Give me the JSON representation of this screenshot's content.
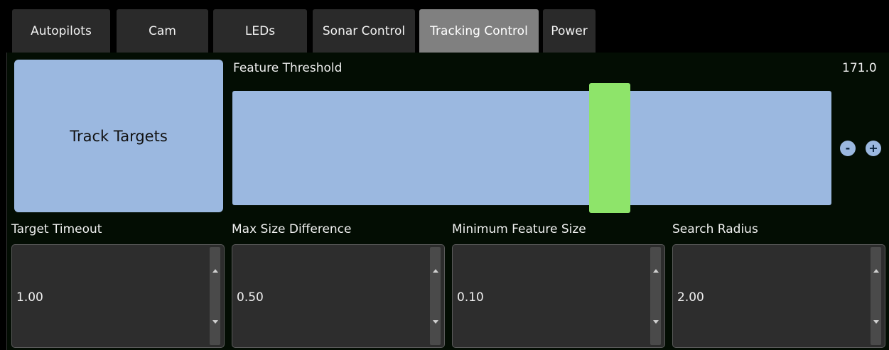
{
  "tabs": [
    "Autopilots",
    "Cam",
    "LEDs",
    "Sonar Control",
    "Tracking Control",
    "Power"
  ],
  "active_tab": "Tracking Control",
  "track_button": "Track Targets",
  "threshold": {
    "label": "Feature Threshold",
    "value_text": "171.0",
    "level": 0.64,
    "minus": "-",
    "plus": "+"
  },
  "spinboxes": [
    {
      "label": "Target Timeout",
      "value": "1.00"
    },
    {
      "label": "Max Size Difference",
      "value": "0.50"
    },
    {
      "label": "Minimum Feature Size",
      "value": "0.10"
    },
    {
      "label": "Search Radius",
      "value": "2.00"
    }
  ],
  "colors": {
    "accent_blue": "#9bb8e0",
    "handle_green": "#8ee46a",
    "active_tab": "#808080",
    "tab": "#2a2a2a"
  }
}
